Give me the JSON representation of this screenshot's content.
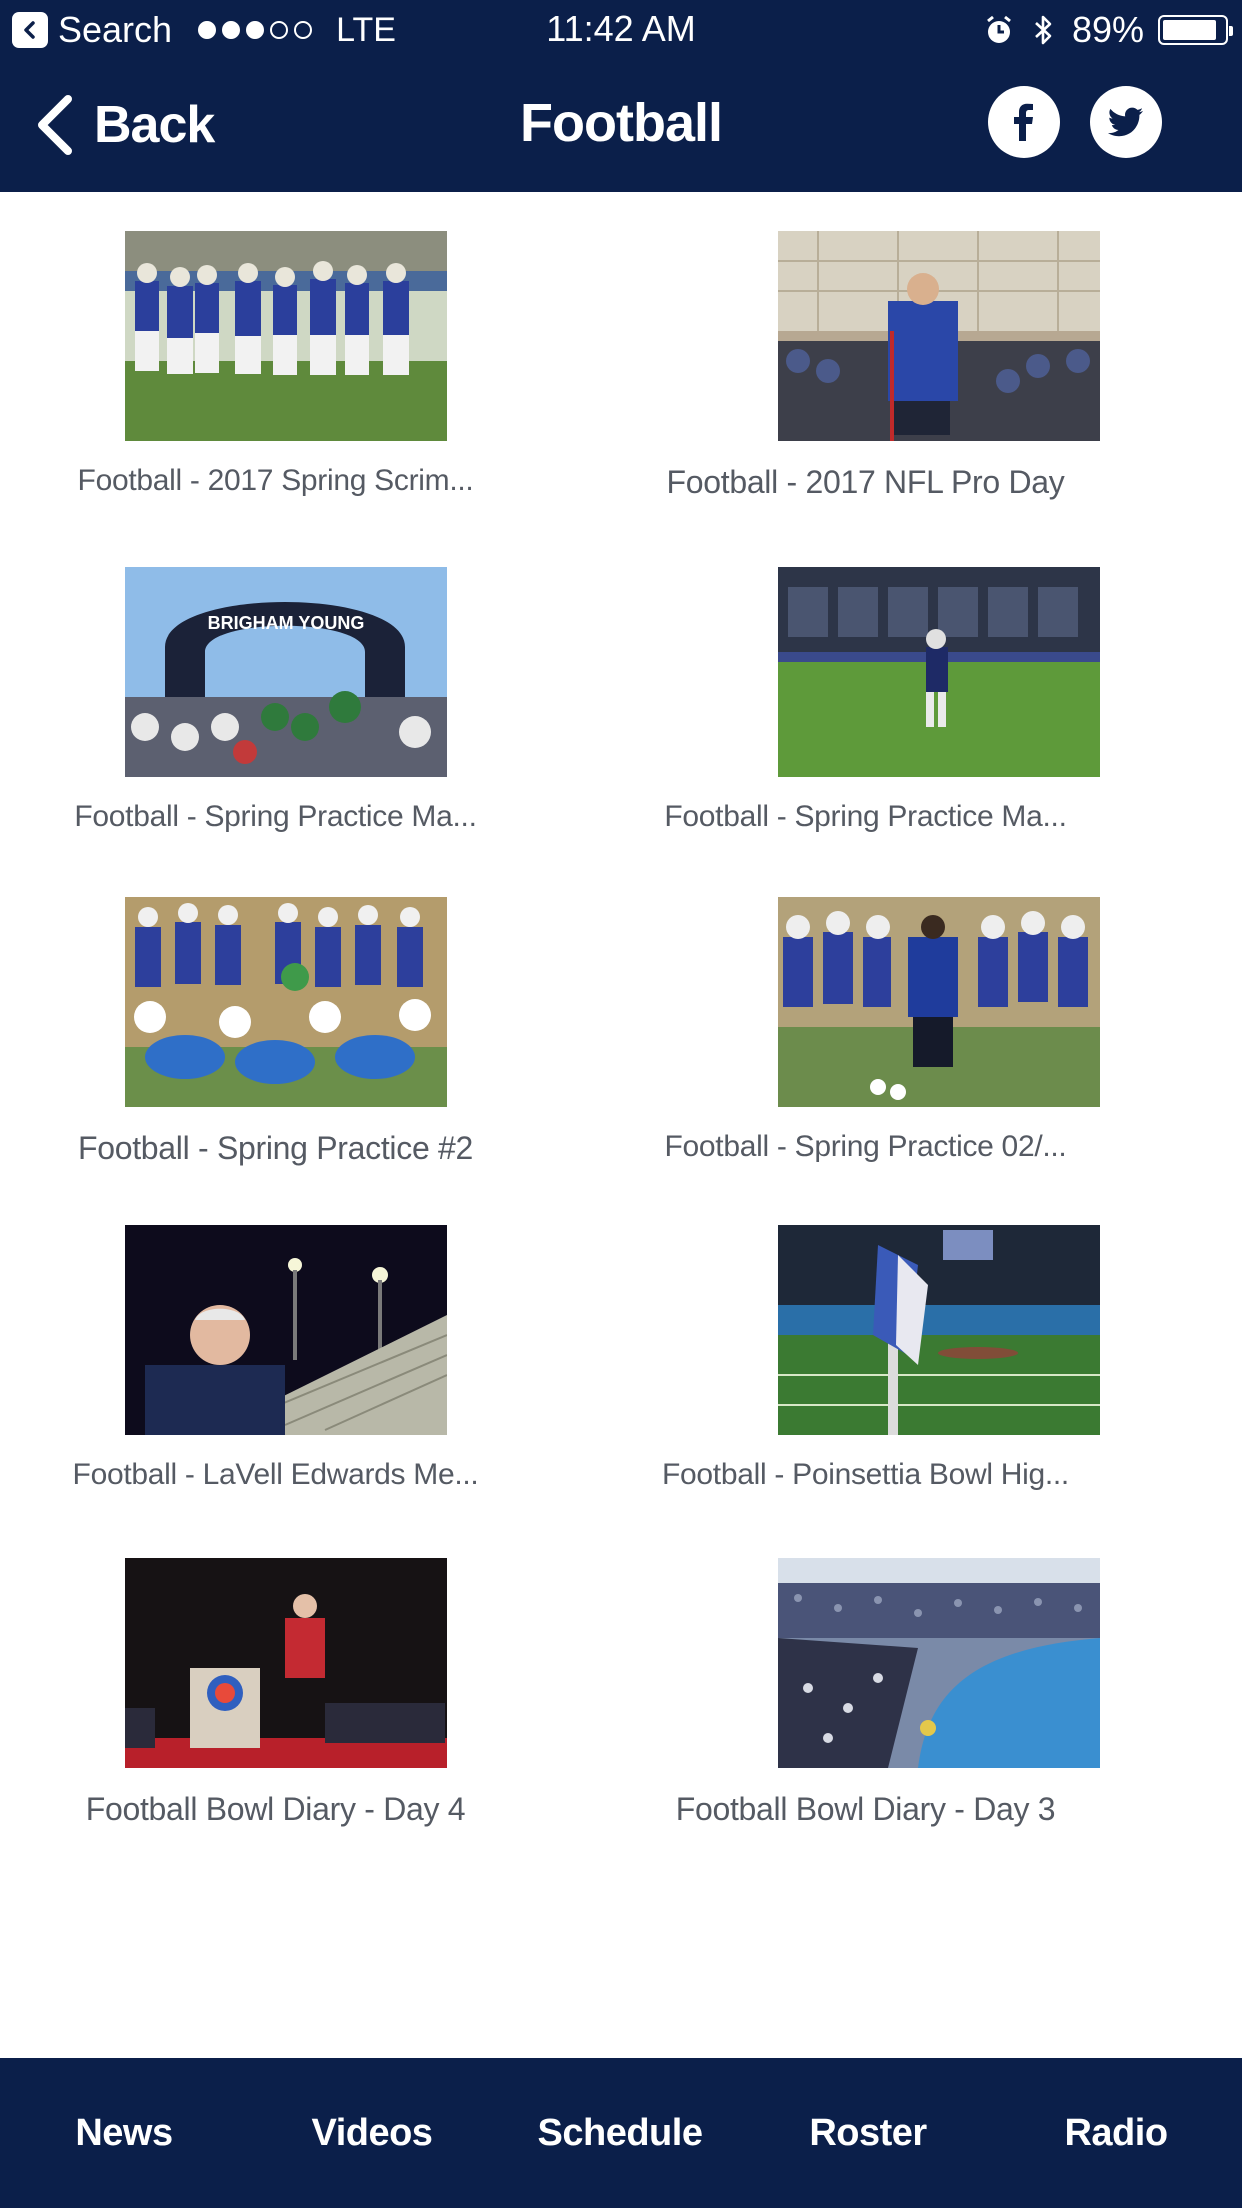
{
  "status_bar": {
    "back_app": "Search",
    "signal_dots_filled": 3,
    "signal_dots_total": 5,
    "carrier": "LTE",
    "time": "11:42 AM",
    "battery_percent": "89%",
    "battery_level": 0.89
  },
  "nav": {
    "back_label": "Back",
    "title": "Football"
  },
  "videos": [
    {
      "title": "Football - 2017 Spring Scrim..."
    },
    {
      "title": "Football - 2017 NFL Pro Day"
    },
    {
      "title": "Football - Spring Practice Ma..."
    },
    {
      "title": "Football - Spring Practice Ma..."
    },
    {
      "title": "Football - Spring Practice #2"
    },
    {
      "title": "Football - Spring Practice 02/..."
    },
    {
      "title": "Football - LaVell Edwards Me..."
    },
    {
      "title": "Football - Poinsettia Bowl Hig..."
    },
    {
      "title": "Football Bowl Diary - Day 4"
    },
    {
      "title": "Football Bowl Diary - Day 3"
    }
  ],
  "arch_text": "BRIGHAM YOUNG",
  "tabs": [
    {
      "label": "News"
    },
    {
      "label": "Videos"
    },
    {
      "label": "Schedule"
    },
    {
      "label": "Roster"
    },
    {
      "label": "Radio"
    }
  ],
  "colors": {
    "brand_navy": "#0b1f4a",
    "title_text": "#555a63"
  }
}
